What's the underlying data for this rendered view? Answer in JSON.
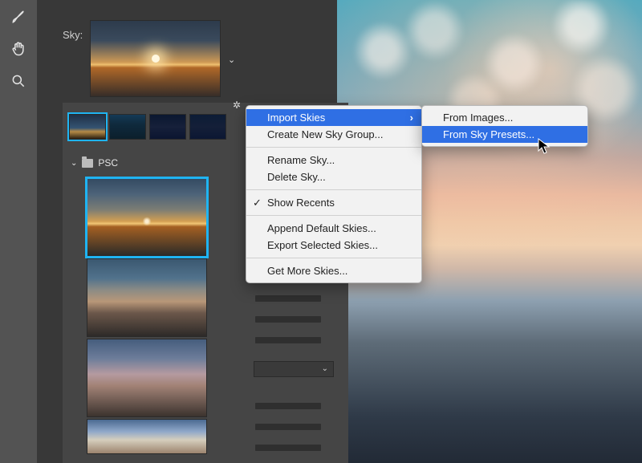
{
  "sky_label": "Sky:",
  "toolbar": {
    "tools": [
      "brush-tool",
      "hand-tool",
      "zoom-tool"
    ]
  },
  "thumb_row": {
    "items": [
      "sunset-1",
      "night-1",
      "stars-1",
      "stars-2"
    ]
  },
  "group": {
    "name": "PSC",
    "items": [
      "psc-sunset-1",
      "psc-coastal-dusk",
      "psc-pink-clouds",
      "psc-pastel-sky"
    ]
  },
  "menu": {
    "import_skies": "Import Skies",
    "create_group": "Create New Sky Group...",
    "rename": "Rename Sky...",
    "delete": "Delete Sky...",
    "show_recents": "Show Recents",
    "append_default": "Append Default Skies...",
    "export_selected": "Export Selected Skies...",
    "get_more": "Get More Skies..."
  },
  "submenu": {
    "from_images": "From Images...",
    "from_presets": "From Sky Presets..."
  },
  "colors": {
    "highlight": "#2f6fe4",
    "selection": "#1fb4f2"
  }
}
